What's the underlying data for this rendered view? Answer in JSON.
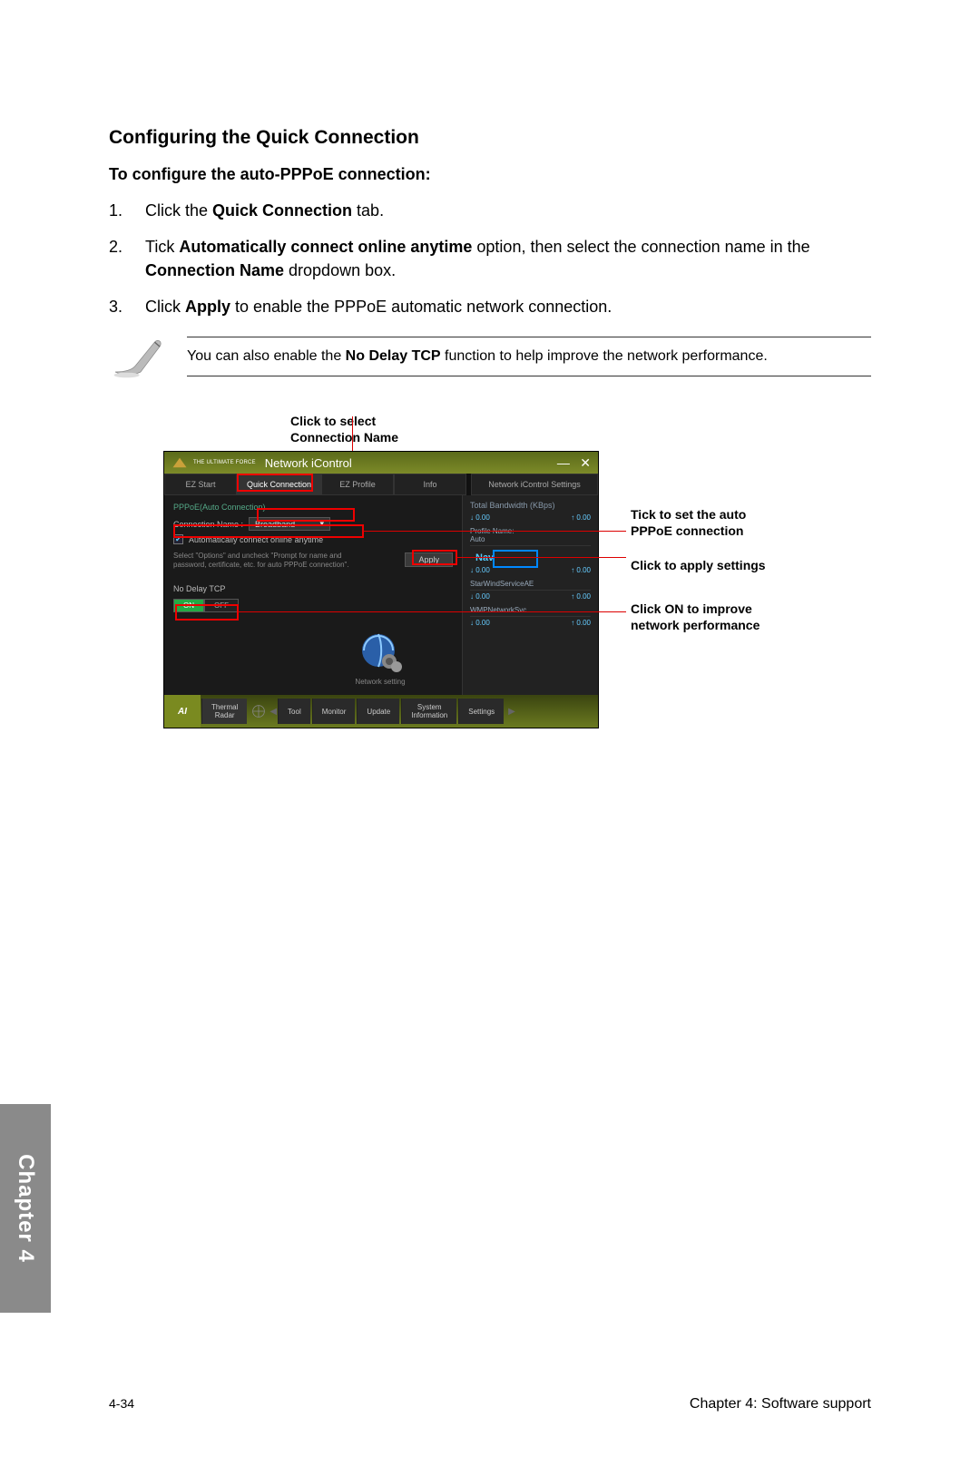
{
  "doc": {
    "section_title": "Configuring the Quick Connection",
    "subhead": "To configure the auto-PPPoE connection:",
    "steps": [
      {
        "n": "1.",
        "html": "Click the <b>Quick Connection</b> tab."
      },
      {
        "n": "2.",
        "html": "Tick <b>Automatically connect online anytime</b> option, then select the connection name in the <b>Connection Name</b> dropdown box."
      },
      {
        "n": "3.",
        "html": "Click <b>Apply</b> to enable the PPPoE automatic network connection."
      }
    ],
    "note_html": "You can also enable the <b>No Delay TCP</b> function to help improve the network performance.",
    "callout_top": "Click to select\nConnection Name",
    "annotations": {
      "a1": "Tick to set the auto PPPoE connection",
      "a2": "Click to apply settings",
      "a3": "Click ON to improve network performance"
    },
    "footer_page": "4-34",
    "footer_chapter": "Chapter 4: Software support",
    "side_tab": "Chapter 4"
  },
  "app": {
    "brand_small": "THE ULTIMATE FORCE",
    "title": "Network iControl",
    "tabs": [
      "EZ Start",
      "Quick Connection",
      "EZ Profile",
      "Info"
    ],
    "right_header": "Network iControl Settings",
    "left": {
      "group": "PPPoE(Auto Connection)",
      "conn_label": "Connection Name :",
      "conn_value": "Broadband",
      "auto_label": "Automatically connect online anytime",
      "hint": "Select \"Options\" and uncheck \"Prompt for name and password, certificate, etc. for auto PPPoE connection\".",
      "apply": "Apply",
      "nodelay": "No Delay TCP",
      "on": "ON",
      "off": "OFF",
      "globe_caption": "Network  setting"
    },
    "right": {
      "bw_label": "Total Bandwidth (KBps)",
      "down": "↓ 0.00",
      "up": "↑ 0.00",
      "profile_label": "Profile Name:",
      "profile_auto": "Auto",
      "nav": "Nav",
      "items": [
        {
          "name": "StarWindServiceAE",
          "d": "↓ 0.00",
          "u": "↑ 0.00"
        },
        {
          "name": "WMPNetworkSvc",
          "d": "↓ 0.00",
          "u": "↑ 0.00"
        }
      ]
    },
    "footer": {
      "thermal": "Thermal\nRadar",
      "items": [
        "Tool",
        "Monitor",
        "Update",
        "System\nInformation",
        "Settings"
      ]
    }
  }
}
